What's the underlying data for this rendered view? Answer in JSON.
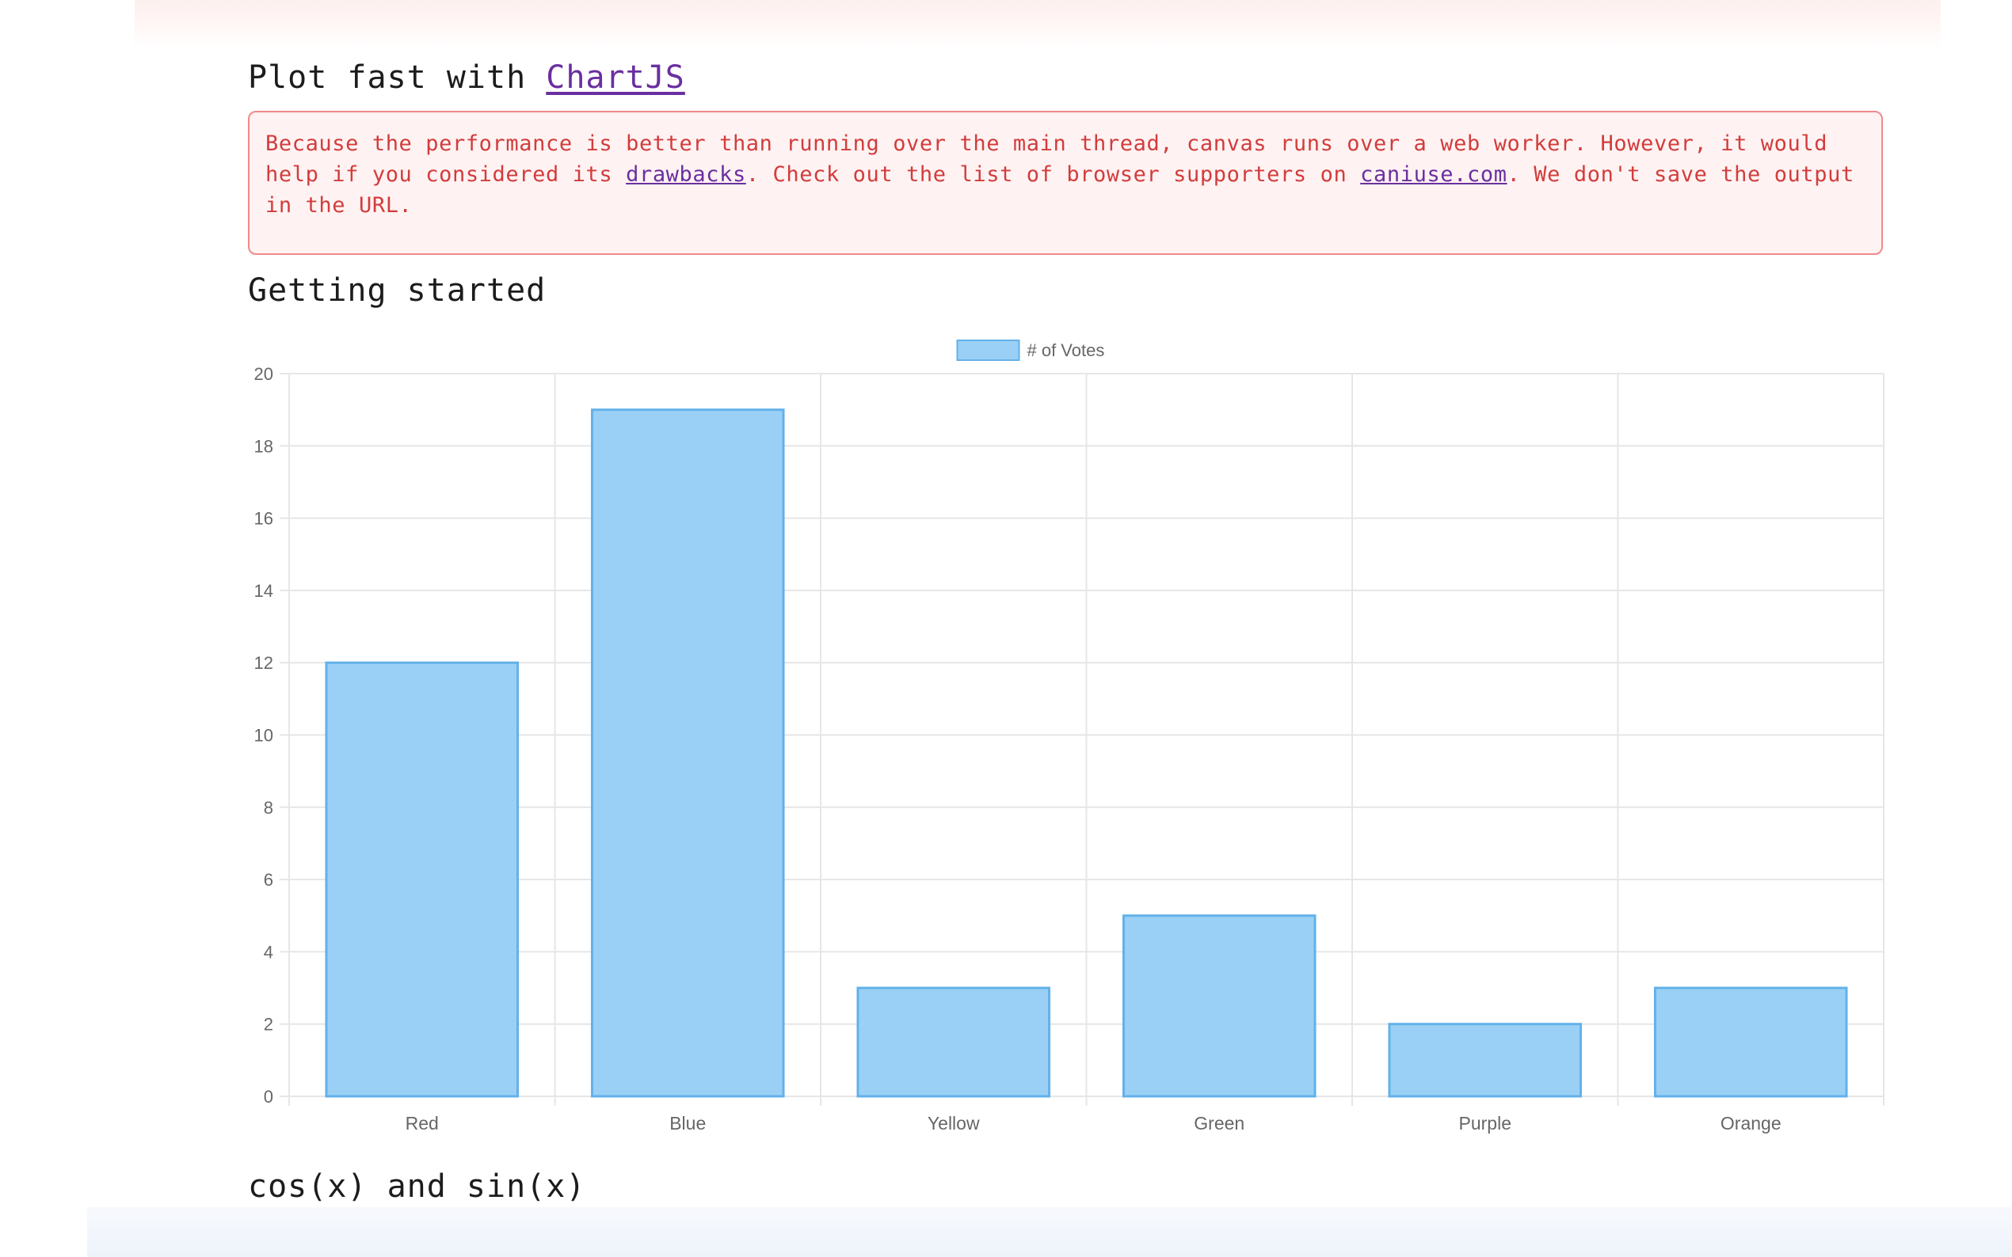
{
  "header": {
    "title_prefix": "Plot fast with",
    "title_link": "ChartJS"
  },
  "warning": {
    "text_1": "Because the performance is better than running over the main thread, canvas runs over a web worker. However, it would help if you considered its",
    "link_1": "drawbacks",
    "text_2": ". Check out the list of browser supporters on",
    "link_2": "caniuse.com",
    "text_3": ". We don't save the output in the URL."
  },
  "sections": {
    "getting_started": "Getting started",
    "cos_sin": "cos(x) and sin(x)"
  },
  "colors": {
    "bar_fill": "#9ad0f5",
    "bar_stroke": "#63b1ea",
    "grid": "#e6e6e6",
    "tick_text": "#666666"
  },
  "chart_data": {
    "type": "bar",
    "title": "",
    "categories": [
      "Red",
      "Blue",
      "Yellow",
      "Green",
      "Purple",
      "Orange"
    ],
    "series": [
      {
        "name": "# of Votes",
        "values": [
          12,
          19,
          3,
          5,
          2,
          3
        ]
      }
    ],
    "xlabel": "",
    "ylabel": "",
    "ylim": [
      0,
      20
    ],
    "yticks": [
      0,
      2,
      4,
      6,
      8,
      10,
      12,
      14,
      16,
      18,
      20
    ],
    "grid": true,
    "legend_position": "top-center"
  }
}
